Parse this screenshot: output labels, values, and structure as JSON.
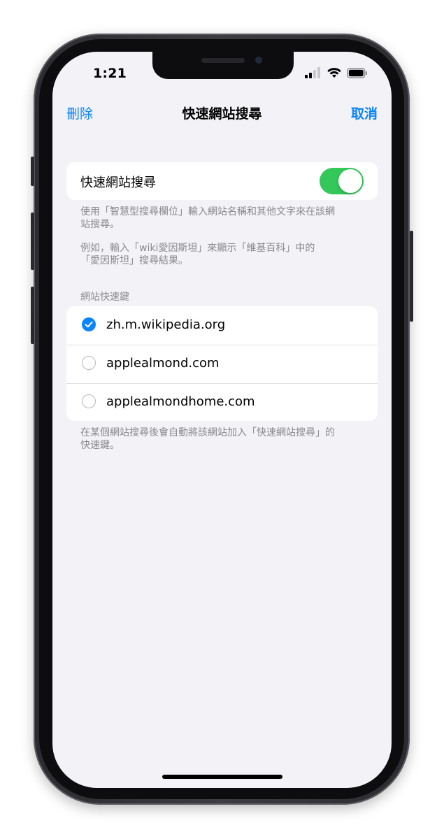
{
  "status_bar": {
    "time": "1:21",
    "icons": [
      "cellular-signal-icon",
      "wifi-icon",
      "battery-icon"
    ]
  },
  "nav": {
    "left_label": "刪除",
    "title": "快速網站搜尋",
    "right_label": "取消"
  },
  "toggle": {
    "label": "快速網站搜尋",
    "on": true
  },
  "footnotes": {
    "line1a": "使用「智慧型搜尋欄位」輸入網站名稱和其他文字來在該網",
    "line1b": "站搜尋。",
    "line2a": "例如，輸入「wiki愛因斯坦」來顯示「維基百科」中的",
    "line2b": "「愛因斯坦」搜尋結果。"
  },
  "section_header": "網站快速鍵",
  "sites": [
    {
      "label": "zh.m.wikipedia.org",
      "checked": true
    },
    {
      "label": "applealmond.com",
      "checked": false
    },
    {
      "label": "applealmondhome.com",
      "checked": false
    }
  ],
  "bottom_note": {
    "line_a": "在某個網站搜尋後會自動將該網站加入「快速網站搜尋」的",
    "line_b": "快速鍵。"
  },
  "colors": {
    "accent": "#0a84ff",
    "toggle_on": "#34c759",
    "background": "#f2f2f7"
  }
}
